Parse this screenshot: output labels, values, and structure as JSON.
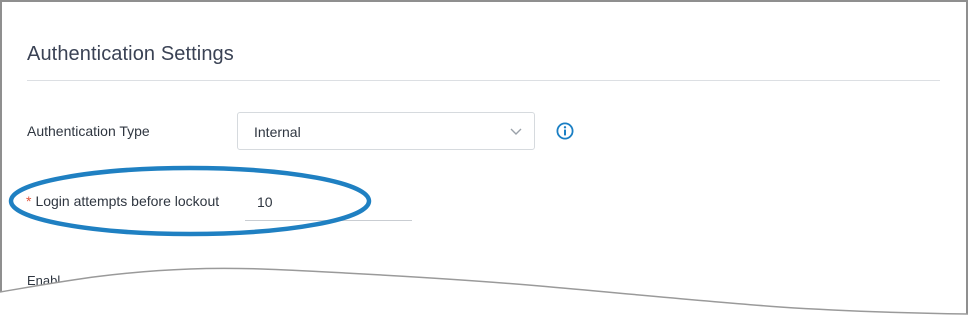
{
  "page": {
    "title": "Authentication Settings"
  },
  "fields": {
    "authentication_type": {
      "label": "Authentication Type",
      "value": "Internal",
      "info_icon": "info-circle-icon"
    },
    "login_attempts": {
      "required_marker": "*",
      "label": "Login attempts before lockout",
      "value": "10"
    },
    "enable_partial_label": "Enabl"
  },
  "colors": {
    "highlight_oval": "#1f80c2",
    "info_icon": "#1a7fc4",
    "required_marker": "#e0533b",
    "title_text": "#3a4254"
  }
}
